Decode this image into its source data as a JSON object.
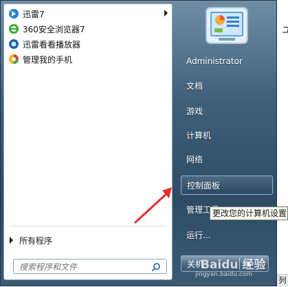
{
  "programs": [
    {
      "label": "迅雷7",
      "icon": "xunlei-icon",
      "has_submenu": true
    },
    {
      "label": "360安全浏览器7",
      "icon": "browser-360-icon",
      "has_submenu": false
    },
    {
      "label": "迅雷看看播放器",
      "icon": "xunlei-player-icon",
      "has_submenu": false
    },
    {
      "label": "管理我的手机",
      "icon": "phone-manager-icon",
      "has_submenu": false
    }
  ],
  "all_programs_label": "所有程序",
  "search": {
    "placeholder": "搜索程序和文件"
  },
  "right_items": [
    {
      "label": "Administrator"
    },
    {
      "label": "文档"
    },
    {
      "label": "游戏"
    },
    {
      "label": "计算机"
    },
    {
      "label": "网络"
    },
    {
      "label": "控制面板",
      "highlighted": true
    },
    {
      "label": "管理工具"
    },
    {
      "label": "运行..."
    }
  ],
  "tooltip": "更改您的计算机设置",
  "shutdown_label": "关机",
  "watermark": {
    "brand": "Baidu 经验",
    "url": "jingyan.baidu.com"
  },
  "edge_text": {
    "top": "ユ",
    "bottom": "列"
  },
  "colors": {
    "accent": "#e03030",
    "panel": "#3f5f79"
  }
}
